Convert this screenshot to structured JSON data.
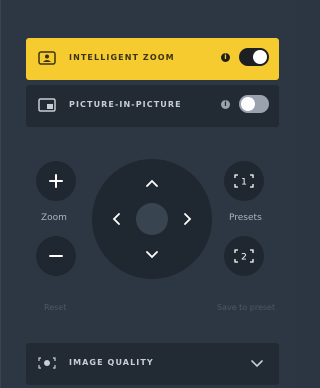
{
  "colors": {
    "accent": "#f5cb30",
    "panel": "#2d3743",
    "row_dark": "#222b34",
    "button_bg": "#1f2730"
  },
  "intelligent_zoom": {
    "label": "INTELLIGENT ZOOM",
    "info_glyph": "i",
    "toggle_on": true,
    "icon": "person-frame-icon"
  },
  "picture_in_picture": {
    "label": "PICTURE-IN-PICTURE",
    "info_glyph": "i",
    "toggle_on": false,
    "icon": "picture-in-picture-icon"
  },
  "controls": {
    "zoom_label": "Zoom",
    "zoom_in_glyph": "+",
    "zoom_out_glyph": "−",
    "presets_label": "Presets",
    "preset_1_label": "1",
    "preset_2_label": "2",
    "reset_label": "Reset",
    "save_preset_label": "Save to preset"
  },
  "image_quality": {
    "label": "IMAGE QUALITY",
    "icon": "camera-eye-icon",
    "expand_icon": "chevron-down-icon"
  }
}
